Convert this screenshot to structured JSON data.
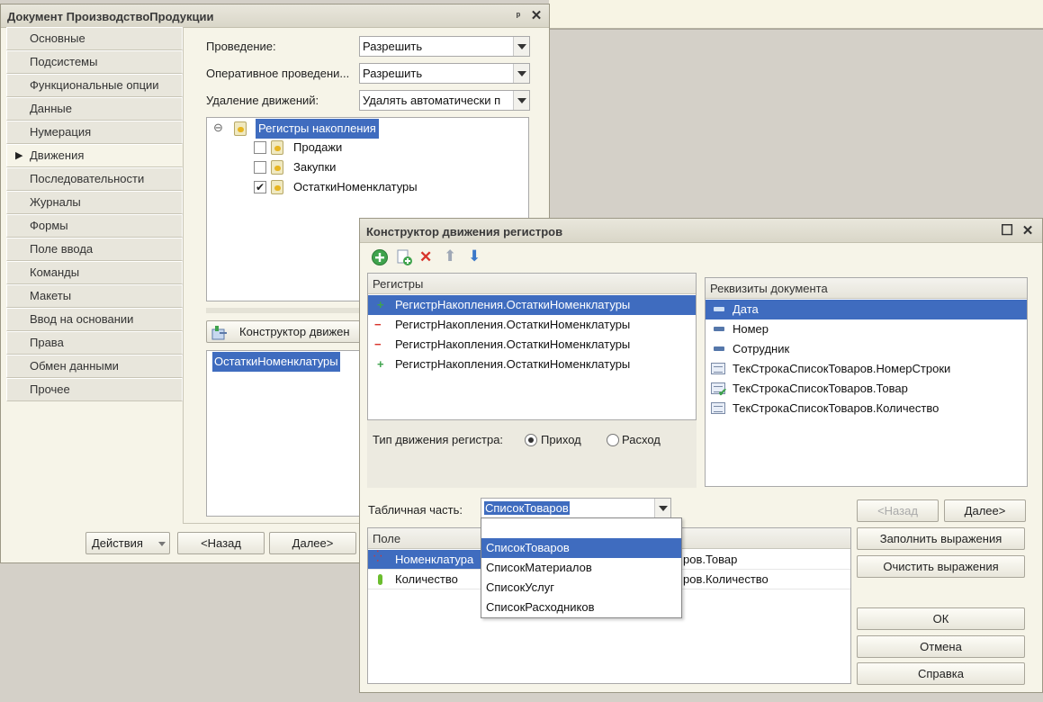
{
  "main_window": {
    "title": "Документ ПроизводствоПродукции",
    "pin_glyph": "ᵖ",
    "close_glyph": "✕",
    "nav": [
      "Основные",
      "Подсистемы",
      "Функциональные опции",
      "Данные",
      "Нумерация",
      "Движения",
      "Последовательности",
      "Журналы",
      "Формы",
      "Поле ввода",
      "Команды",
      "Макеты",
      "Ввод на основании",
      "Права",
      "Обмен данными",
      "Прочее"
    ],
    "active_nav_arrow": "▶",
    "fields": {
      "posting_label": "Проведение:",
      "posting_value": "Разрешить",
      "realtime_label": "Оперативное проведени...",
      "realtime_value": "Разрешить",
      "delete_label": "Удаление движений:",
      "delete_value": "Удалять автоматически п"
    },
    "tree": {
      "root": "Регистры накопления",
      "items": [
        {
          "label": "Продажи",
          "checked": false
        },
        {
          "label": "Закупки",
          "checked": false
        },
        {
          "label": "ОстаткиНоменклатуры",
          "checked": true
        }
      ],
      "check_glyph": "✔",
      "collapse_glyph": "⊖"
    },
    "constructor_button": "Конструктор движен",
    "movements_list": [
      "ОстаткиНоменклатуры"
    ],
    "bottom": {
      "actions": "Действия",
      "back": "<Назад",
      "next": "Далее>"
    }
  },
  "constructor": {
    "title": "Конструктор движения регистров",
    "max_glyph": "☐",
    "close_glyph": "✕",
    "toolbar": {
      "add": "+",
      "delete": "✕",
      "up": "⬆",
      "down": "⬇"
    },
    "registers_header": "Регистры",
    "registers": [
      {
        "label": "РегистрНакопления.ОстаткиНоменклатуры",
        "sign": "+",
        "selected": true
      },
      {
        "label": "РегистрНакопления.ОстаткиНоменклатуры",
        "sign": "−",
        "selected": false
      },
      {
        "label": "РегистрНакопления.ОстаткиНоменклатуры",
        "sign": "−",
        "selected": false
      },
      {
        "label": "РегистрНакопления.ОстаткиНоменклатуры",
        "sign": "+",
        "selected": false
      }
    ],
    "movement_type_label": "Тип движения регистра:",
    "radio_in": "Приход",
    "radio_out": "Расход",
    "doc_attrs_header": "Реквизиты документа",
    "doc_attrs": [
      {
        "label": "Дата",
        "selected": true
      },
      {
        "label": "Номер",
        "selected": false
      },
      {
        "label": "Сотрудник",
        "selected": false
      },
      {
        "label": "ТекСтрокаСписокТоваров.НомерСтроки",
        "selected": false
      },
      {
        "label": "ТекСтрокаСписокТоваров.Товар",
        "selected": false
      },
      {
        "label": "ТекСтрокаСписокТоваров.Количество",
        "selected": false
      }
    ],
    "tabular_label": "Табличная часть:",
    "tabular_value": "СписокТоваров",
    "dropdown_options": [
      "СписокТоваров",
      "СписокМатериалов",
      "СписокУслуг",
      "СписокРасходников"
    ],
    "fields_header": "Поле",
    "fields_rows": [
      {
        "field": "Номенклатура",
        "expr": "ров.Товар"
      },
      {
        "field": "Количество",
        "expr": "ров.Количество"
      }
    ],
    "buttons": {
      "back": "<Назад",
      "next": "Далее>",
      "fill": "Заполнить выражения",
      "clear": "Очистить выражения",
      "ok": "ОК",
      "cancel": "Отмена",
      "help": "Справка"
    }
  },
  "colors": {
    "selection": "#3f6cbf",
    "window_bg": "#f6f4e8",
    "desktop": "#d4d0c8"
  }
}
